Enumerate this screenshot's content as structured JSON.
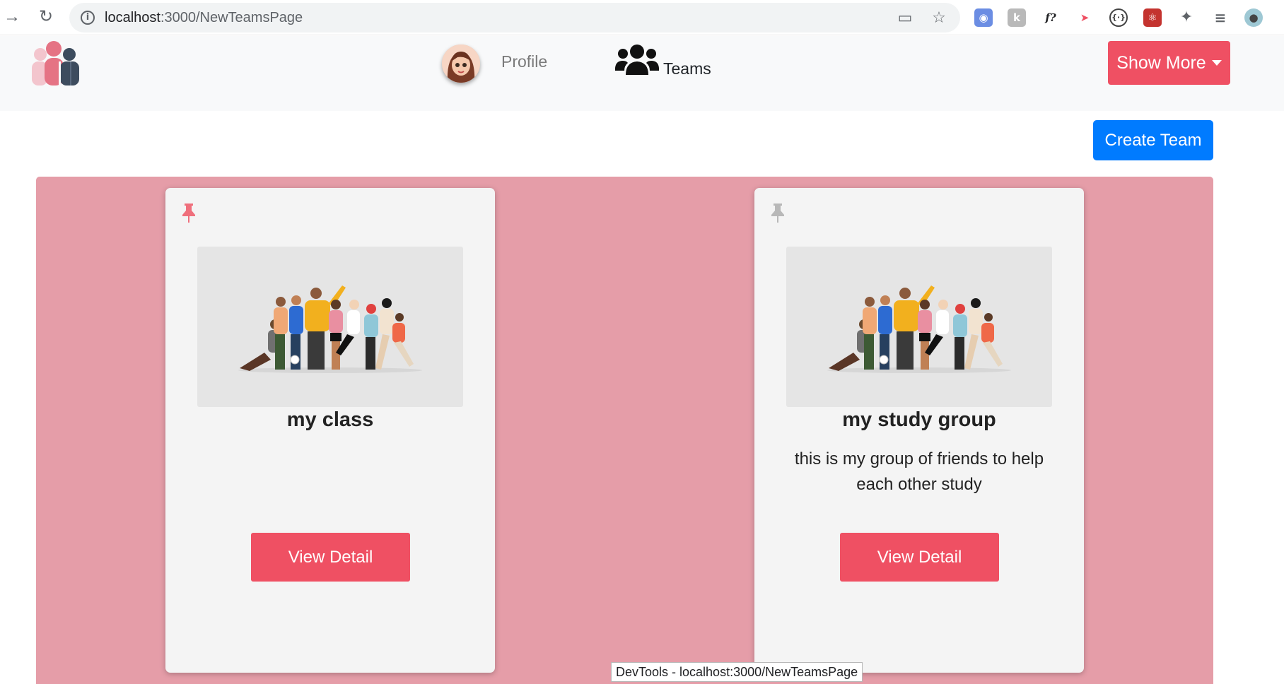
{
  "browser": {
    "url_host": "localhost",
    "url_path": ":3000/NewTeamsPage",
    "status_text": "DevTools - localhost:3000/NewTeamsPage"
  },
  "navbar": {
    "profile_label": "Profile",
    "teams_label": "Teams",
    "show_more_label": "Show More"
  },
  "create_team_label": "Create Team",
  "teams": [
    {
      "title": "my class",
      "description": "",
      "button": "View Detail",
      "pinned": true
    },
    {
      "title": "my study group",
      "description": "this is my group of friends to help each other study",
      "button": "View Detail",
      "pinned": false
    }
  ],
  "colors": {
    "accent": "#ef5063",
    "primary": "#007bff",
    "team_area": "#e59da8"
  }
}
